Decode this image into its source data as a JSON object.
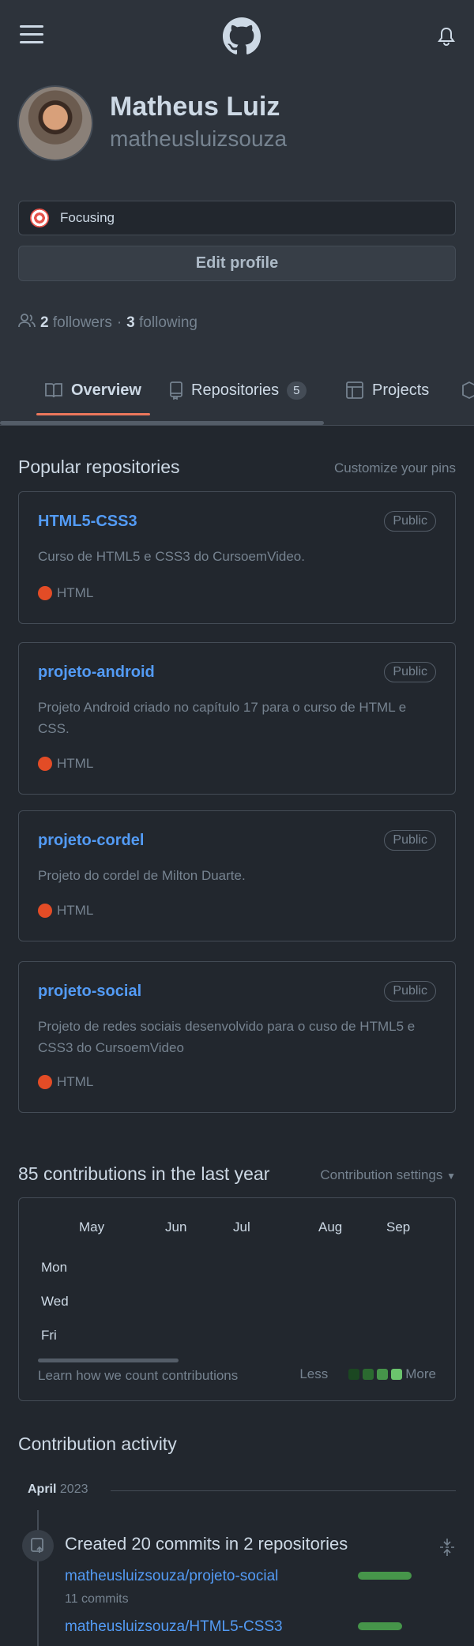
{
  "header": {
    "menu_icon": "hamburger-menu-icon",
    "logo_icon": "github-logo-icon",
    "notifications_icon": "bell-icon"
  },
  "profile": {
    "name": "Matheus Luiz",
    "login": "matheusluizsouza",
    "status": "Focusing",
    "edit_label": "Edit profile",
    "followers_count": "2",
    "followers_label": "followers",
    "separator": "·",
    "following_count": "3",
    "following_label": "following"
  },
  "tabs": [
    {
      "label": "Overview",
      "icon": "book-icon"
    },
    {
      "label": "Repositories",
      "icon": "repo-icon",
      "count": "5"
    },
    {
      "label": "Projects",
      "icon": "table-icon"
    }
  ],
  "pinned": {
    "title": "Popular repositories",
    "customize": "Customize your pins",
    "repos": [
      {
        "name": "HTML5-CSS3",
        "visibility": "Public",
        "description": "Curso de HTML5 e CSS3 do CursoemVideo.",
        "language": "HTML"
      },
      {
        "name": "projeto-android",
        "visibility": "Public",
        "description": "Projeto Android criado no capítulo 17 para o curso de HTML e CSS.",
        "language": "HTML"
      },
      {
        "name": "projeto-cordel",
        "visibility": "Public",
        "description": "Projeto do cordel de Milton Duarte.",
        "language": "HTML"
      },
      {
        "name": "projeto-social",
        "visibility": "Public",
        "description": "Projeto de redes sociais desenvolvido para o cuso de HTML5 e CSS3 do CursoemVideo",
        "language": "HTML"
      }
    ]
  },
  "contributions": {
    "title": "85 contributions in the last year",
    "settings": "Contribution settings",
    "months": [
      "May",
      "Jun",
      "Jul",
      "Aug",
      "Sep"
    ],
    "days": [
      "Mon",
      "Wed",
      "Fri"
    ],
    "learn": "Learn how we count contributions",
    "less": "Less",
    "more": "More",
    "legend_colors": [
      "#1b4721",
      "#2b6a30",
      "#46954a",
      "#6bc46d"
    ]
  },
  "activity": {
    "title": "Contribution activity",
    "month": "April",
    "year": "2023",
    "event": "Created 20 commits in 2 repositories",
    "repos": [
      {
        "name": "matheusluizsouza/projeto-social",
        "commits": "11 commits",
        "fraction": 0.55
      },
      {
        "name": "matheusluizsouza/HTML5-CSS3",
        "fraction": 0.45
      }
    ],
    "accent": "#46954a"
  },
  "colors": {
    "link": "#539bf5",
    "language_html": "#e34c26",
    "tab_accent": "#ec775c"
  }
}
